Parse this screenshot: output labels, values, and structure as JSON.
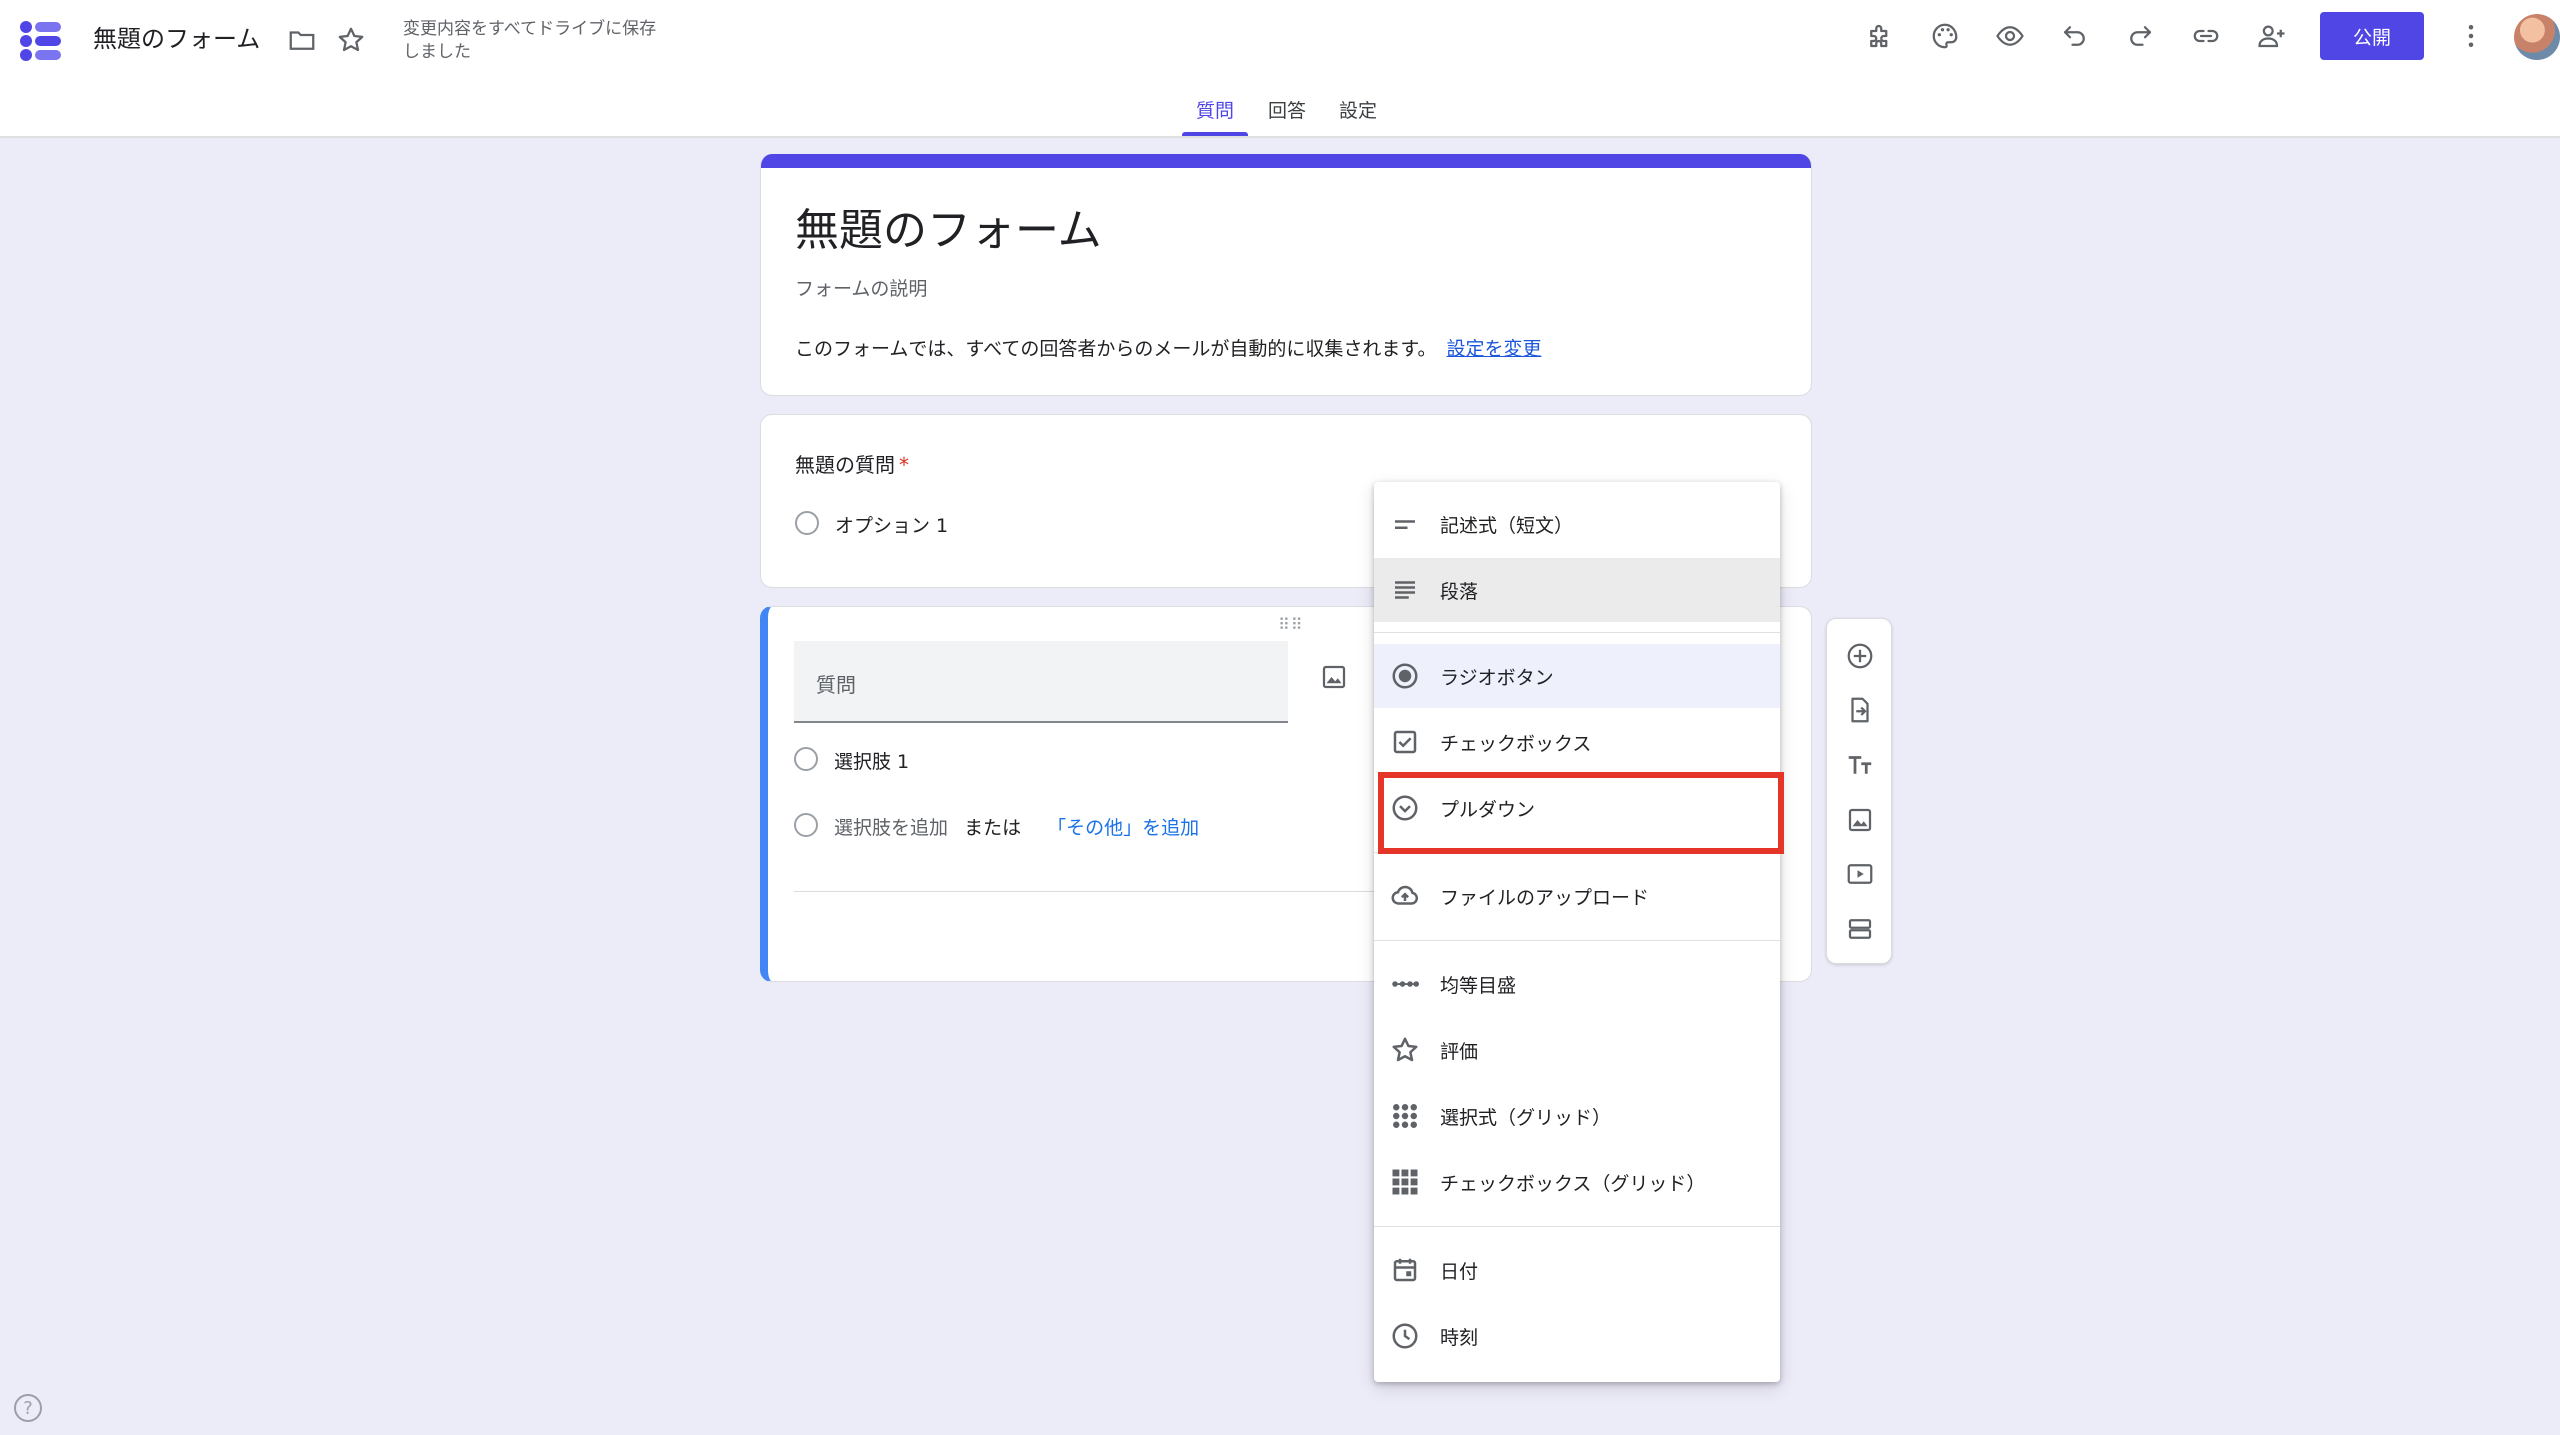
{
  "header": {
    "doc_title": "無題のフォーム",
    "save_status": "変更内容をすべてドライブに保存しました",
    "publish_label": "公開",
    "icons": [
      "folder-icon",
      "star-icon",
      "addon-icon",
      "palette-icon",
      "preview-icon",
      "undo-icon",
      "redo-icon",
      "link-icon",
      "add-collaborator-icon",
      "more-vert-icon"
    ]
  },
  "tabs": [
    {
      "label": "質問",
      "active": true
    },
    {
      "label": "回答",
      "active": false
    },
    {
      "label": "設定",
      "active": false
    }
  ],
  "form": {
    "title": "無題のフォーム",
    "description_placeholder": "フォームの説明",
    "email_note": "このフォームでは、すべての回答者からのメールが自動的に収集されます。",
    "change_settings_link": "設定を変更"
  },
  "question1": {
    "title": "無題の質問",
    "required_mark": "*",
    "option": "オプション 1"
  },
  "question2": {
    "placeholder": "質問",
    "option1": "選択肢 1",
    "add_option": "選択肢を追加",
    "or": "または",
    "add_other": "「その他」を追加"
  },
  "menu": {
    "items": [
      {
        "label": "記述式（短文）",
        "icon": "short-text-icon"
      },
      {
        "label": "段落",
        "icon": "paragraph-icon"
      },
      {
        "label": "ラジオボタン",
        "icon": "radio-button-icon"
      },
      {
        "label": "チェックボックス",
        "icon": "checkbox-icon"
      },
      {
        "label": "プルダウン",
        "icon": "dropdown-icon"
      },
      {
        "label": "ファイルのアップロード",
        "icon": "cloud-upload-icon"
      },
      {
        "label": "均等目盛",
        "icon": "linear-scale-icon"
      },
      {
        "label": "評価",
        "icon": "star-icon"
      },
      {
        "label": "選択式（グリッド）",
        "icon": "grid-dots-icon"
      },
      {
        "label": "チェックボックス（グリッド）",
        "icon": "grid-squares-icon"
      },
      {
        "label": "日付",
        "icon": "calendar-icon"
      },
      {
        "label": "時刻",
        "icon": "clock-icon"
      }
    ],
    "hovered": "段落",
    "selected": "ラジオボタン",
    "highlighted": "プルダウン"
  },
  "toolbar": {
    "icons": [
      "add-question-icon",
      "import-questions-icon",
      "add-title-icon",
      "add-image-icon",
      "add-video-icon",
      "add-section-icon"
    ]
  },
  "colors": {
    "accent": "#4f46e5",
    "highlight_box": "#e53529",
    "active_card_border": "#4285f4",
    "background": "#ecebf8"
  }
}
